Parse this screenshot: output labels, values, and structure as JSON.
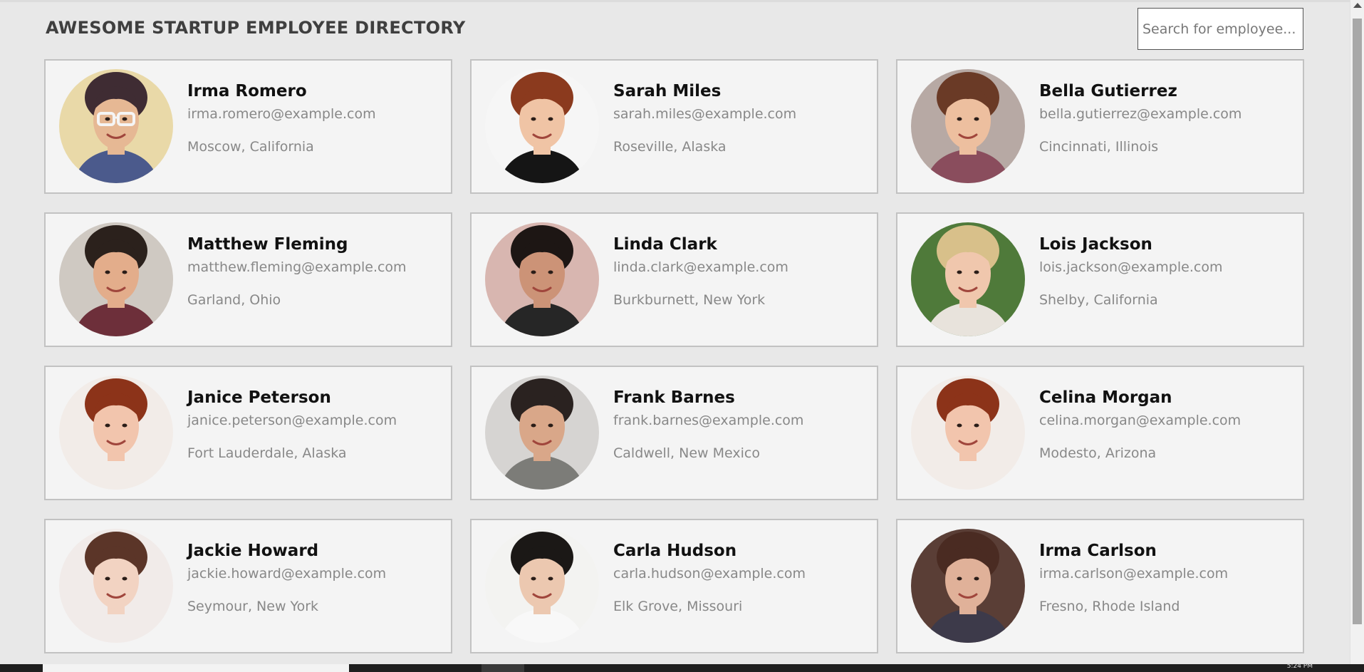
{
  "header": {
    "title": "AWESOME STARTUP EMPLOYEE DIRECTORY"
  },
  "search": {
    "placeholder": "Search for employee..."
  },
  "employees": [
    {
      "name": "Irma Romero",
      "email": "irma.romero@example.com",
      "location": "Moscow, California",
      "avatar": {
        "bg": "#e9d9a8",
        "hair": "#3f2c33",
        "skin": "#e6b894",
        "shirt": "#4b5a8c",
        "glasses": true
      }
    },
    {
      "name": "Sarah Miles",
      "email": "sarah.miles@example.com",
      "location": "Roseville, Alaska",
      "avatar": {
        "bg": "#f6f6f6",
        "hair": "#8b3a1e",
        "skin": "#f0c4a5",
        "shirt": "#151515",
        "glasses": false
      }
    },
    {
      "name": "Bella Gutierrez",
      "email": "bella.gutierrez@example.com",
      "location": "Cincinnati, Illinois",
      "avatar": {
        "bg": "#b7a9a4",
        "hair": "#6a3a26",
        "skin": "#edbf9f",
        "shirt": "#8a4d5d",
        "glasses": false
      }
    },
    {
      "name": "Matthew Fleming",
      "email": "matthew.fleming@example.com",
      "location": "Garland, Ohio",
      "avatar": {
        "bg": "#cfc9c2",
        "hair": "#2b211c",
        "skin": "#e3ad8b",
        "shirt": "#6d2f3a",
        "glasses": false
      }
    },
    {
      "name": "Linda Clark",
      "email": "linda.clark@example.com",
      "location": "Burkburnett, New York",
      "avatar": {
        "bg": "#d8b6b0",
        "hair": "#1d1614",
        "skin": "#cc9377",
        "shirt": "#262626",
        "glasses": false
      }
    },
    {
      "name": "Lois Jackson",
      "email": "lois.jackson@example.com",
      "location": "Shelby, California",
      "avatar": {
        "bg": "#4f7a3a",
        "hair": "#d8c08a",
        "skin": "#f0c7ad",
        "shirt": "#e8e3dc",
        "glasses": false
      }
    },
    {
      "name": "Janice Peterson",
      "email": "janice.peterson@example.com",
      "location": "Fort Lauderdale, Alaska",
      "avatar": {
        "bg": "#f2ece8",
        "hair": "#8c3319",
        "skin": "#f2c5ad",
        "shirt": "#f2ece8",
        "glasses": false
      }
    },
    {
      "name": "Frank Barnes",
      "email": "frank.barnes@example.com",
      "location": "Caldwell, New Mexico",
      "avatar": {
        "bg": "#d6d4d2",
        "hair": "#2a2220",
        "skin": "#d9a789",
        "shirt": "#7c7c78",
        "glasses": false
      }
    },
    {
      "name": "Celina Morgan",
      "email": "celina.morgan@example.com",
      "location": "Modesto, Arizona",
      "avatar": {
        "bg": "#f2ece8",
        "hair": "#8c3319",
        "skin": "#f2c5ad",
        "shirt": "#f2ece8",
        "glasses": false
      }
    },
    {
      "name": "Jackie Howard",
      "email": "jackie.howard@example.com",
      "location": "Seymour, New York",
      "avatar": {
        "bg": "#f1ebe9",
        "hair": "#5b3528",
        "skin": "#f2d3c2",
        "shirt": "#f1ebe9",
        "glasses": false
      }
    },
    {
      "name": "Carla Hudson",
      "email": "carla.hudson@example.com",
      "location": "Elk Grove, Missouri",
      "avatar": {
        "bg": "#f3f3f1",
        "hair": "#1b1816",
        "skin": "#ecc8b0",
        "shirt": "#f8f8f8",
        "glasses": false
      }
    },
    {
      "name": "Irma Carlson",
      "email": "irma.carlson@example.com",
      "location": "Fresno, Rhode Island",
      "avatar": {
        "bg": "#5a3e36",
        "hair": "#4a2b22",
        "skin": "#e0b199",
        "shirt": "#3d3a4a",
        "glasses": false
      }
    }
  ],
  "taskbar": {
    "clock": "5:24 PM"
  }
}
